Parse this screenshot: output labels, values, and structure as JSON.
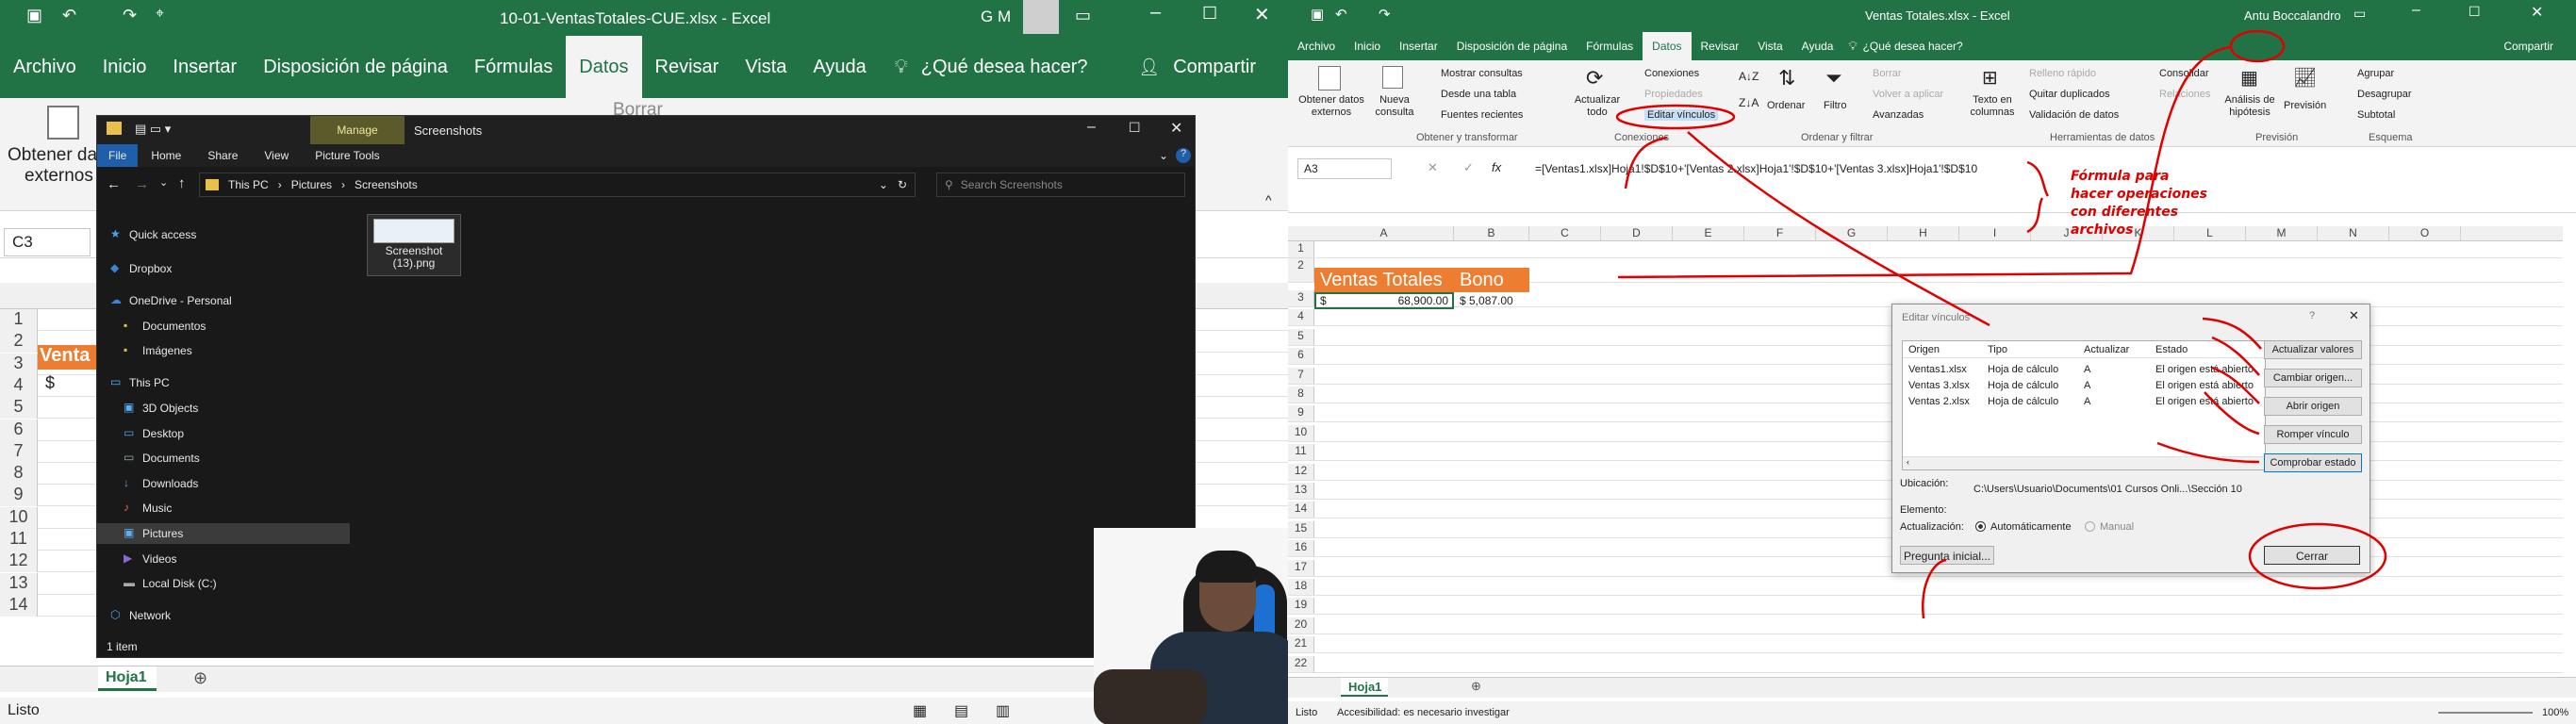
{
  "left": {
    "title": "10-01-VentasTotales-CUE.xlsx  -  Excel",
    "user": "G M",
    "tabs": [
      "Archivo",
      "Inicio",
      "Insertar",
      "Disposición de página",
      "Fórmulas",
      "Datos",
      "Revisar",
      "Vista",
      "Ayuda"
    ],
    "tell": "¿Qué desea hacer?",
    "share": "Compartir",
    "ribbon_get": "Obtener da",
    "ribbon_ext": "externos",
    "borrar": "Borrar",
    "namebox": "C3",
    "rows": [
      "1",
      "2",
      "3",
      "4",
      "5",
      "6",
      "7",
      "8",
      "9",
      "10",
      "11",
      "12",
      "13",
      "14"
    ],
    "a2": "Venta",
    "a3": "$",
    "sheet": "Hoja1",
    "status": "Listo"
  },
  "explorer": {
    "manage": "Manage",
    "title": "Screenshots",
    "tabs": [
      "File",
      "Home",
      "Share",
      "View",
      "Picture Tools"
    ],
    "path": [
      "This PC",
      "Pictures",
      "Screenshots"
    ],
    "search": "Search Screenshots",
    "nav": [
      "Quick access",
      "Dropbox",
      "OneDrive - Personal",
      "Documentos",
      "Imágenes",
      "This PC",
      "3D Objects",
      "Desktop",
      "Documents",
      "Downloads",
      "Music",
      "Pictures",
      "Videos",
      "Local Disk (C:)",
      "Network"
    ],
    "file_name": "Screenshot (13).png",
    "items": "1 item"
  },
  "right": {
    "title": "Ventas Totales.xlsx  -  Excel",
    "user": "Antu Boccalandro",
    "tabs": [
      "Archivo",
      "Inicio",
      "Insertar",
      "Disposición de página",
      "Fórmulas",
      "Datos",
      "Revisar",
      "Vista",
      "Ayuda"
    ],
    "tell": "¿Qué desea hacer?",
    "share": "Compartir",
    "g1": {
      "obtener": "Obtener datos externos",
      "nueva": "Nueva consulta",
      "mostrar": "Mostrar consultas",
      "desde": "Desde una tabla",
      "fuentes": "Fuentes recientes",
      "label": "Obtener y transformar"
    },
    "g2": {
      "actualizar": "Actualizar todo",
      "conexiones": "Conexiones",
      "propiedades": "Propiedades",
      "editar": "Editar vínculos",
      "label": "Conexiones"
    },
    "g3": {
      "ordenar": "Ordenar",
      "filtro": "Filtro",
      "borrar": "Borrar",
      "volver": "Volver a aplicar",
      "avanzadas": "Avanzadas",
      "label": "Ordenar y filtrar"
    },
    "g4": {
      "texto": "Texto en columnas",
      "relleno": "Relleno rápido",
      "quitar": "Quitar duplicados",
      "validacion": "Validación de datos",
      "consolidar": "Consolidar",
      "relaciones": "Relaciones",
      "label": "Herramientas de datos"
    },
    "g5": {
      "analisis": "Análisis de hipótesis",
      "prevision": "Previsión",
      "label": "Previsión"
    },
    "g6": {
      "agrupar": "Agrupar",
      "desagrupar": "Desagrupar",
      "subtotal": "Subtotal",
      "label": "Esquema"
    },
    "namebox": "A3",
    "formula": "=[Ventas1.xlsx]Hoja1!$D$10+'[Ventas 2.xlsx]Hoja1'!$D$10+'[Ventas 3.xlsx]Hoja1'!$D$10",
    "cols": [
      "A",
      "B",
      "C",
      "D",
      "E",
      "F",
      "G",
      "H",
      "I",
      "J",
      "K",
      "L",
      "M",
      "N",
      "O"
    ],
    "rows": [
      "1",
      "2",
      "3",
      "4",
      "5",
      "6",
      "7",
      "8",
      "9",
      "10",
      "11",
      "12",
      "13",
      "14",
      "15",
      "16",
      "17",
      "18",
      "19",
      "20",
      "21",
      "22"
    ],
    "a2": "Ventas Totales",
    "b2": "Bono",
    "a3_sym": "$",
    "a3_val": "68,900.00",
    "b3": "$  5,087.00",
    "note": [
      "Fórmula para",
      "hacer operaciones",
      "con diferentes",
      "archivos"
    ],
    "sheet": "Hoja1",
    "status": "Listo",
    "access": "Accesibilidad: es necesario investigar",
    "zoom": "100%"
  },
  "dialog": {
    "title": "Editar vínculos",
    "help": "?",
    "headers": [
      "Origen",
      "Tipo",
      "Actualizar",
      "Estado"
    ],
    "rows": [
      [
        "Ventas1.xlsx",
        "Hoja de cálculo",
        "A",
        "El origen está abierto"
      ],
      [
        "Ventas 3.xlsx",
        "Hoja de cálculo",
        "A",
        "El origen está abierto"
      ],
      [
        "Ventas 2.xlsx",
        "Hoja de cálculo",
        "A",
        "El origen está abierto"
      ]
    ],
    "buttons": [
      "Actualizar valores",
      "Cambiar origen...",
      "Abrir origen",
      "Romper vínculo",
      "Comprobar estado"
    ],
    "ubicacion_l": "Ubicación:",
    "ubicacion_v": "C:\\Users\\Usuario\\Documents\\01 Cursos Onli...\\Sección 10",
    "elemento_l": "Elemento:",
    "act_l": "Actualización:",
    "auto": "Automáticamente",
    "manual": "Manual",
    "pregunta": "Pregunta inicial...",
    "cerrar": "Cerrar"
  },
  "colors": {
    "excel_green": "#217346",
    "header_orange": "#ed7d31",
    "annot_red": "#e00000"
  }
}
